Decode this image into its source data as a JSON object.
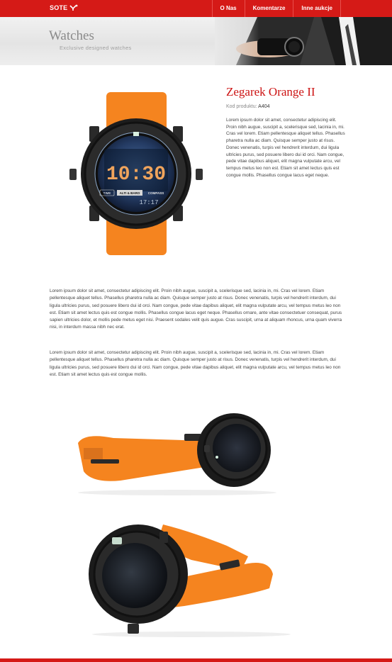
{
  "header": {
    "logo_text": "SOTE",
    "nav": [
      {
        "label": "O Nas"
      },
      {
        "label": "Komentarze"
      },
      {
        "label": "Inne aukcje"
      }
    ]
  },
  "hero": {
    "title": "Watches",
    "subtitle": "Exclusive designed watches"
  },
  "product": {
    "title": "Zegarek Orange II",
    "code_label": "Kod produktu:",
    "code_value": "A404",
    "description": "Lorem ipsum dolor sit amet, consectetur adipiscing elit. Proin nibh augue, suscipit a, scelerisque sed, lacinia in, mi. Cras vel lorem. Etiam pellentesque aliquet tellus. Phasellus pharetra nulla ac diam. Quisque semper justo at risus. Donec venenatis, turpis vel hendrerit interdum, dui ligula ultricies purus, sed posuere libero dui id orci. Nam congue, pede vitae dapibus aliquet, elit magna vulputate arcu, vel tempus metus leo non est. Etiam sit amet lectus quis est congue mollis. Phasellus congue lacus eget neque.",
    "watch_display": {
      "time": "10:30",
      "left_label": "TIME",
      "mode_1": "ALTI & BARO",
      "mode_2": "COMPASS",
      "seconds": "17:17"
    }
  },
  "content": {
    "paragraph_1": "Lorem ipsum dolor sit amet, consectetur adipiscing elit. Proin nibh augue, suscipit a, scelerisque sed, lacinia in, mi. Cras vel lorem. Etiam pellentesque aliquet tellus. Phasellus pharetra nulla ac diam. Quisque semper justo at risus. Donec venenatis, turpis vel hendrerit interdum, dui ligula ultricies purus, sed posuere libero dui id orci. Nam congue, pede vitae dapibus aliquet, elit magna vulputate arcu, vel tempus metus leo non est. Etiam sit amet lectus quis est congue mollis. Phasellus congue lacus eget neque. Phasellus ornare, ante vitae consectetuer consequat, purus sapien ultricies dolor, et mollis pede metus eget nisi. Praesent sodales velit quis augue. Cras suscipit, urna at aliquam rhoncus, urna quam viverra nisi, in interdum massa nibh nec erat.",
    "paragraph_2": "Lorem ipsum dolor sit amet, consectetur adipiscing elit. Proin nibh augue, suscipit a, scelerisque sed, lacinia in, mi. Cras vel lorem. Etiam pellentesque aliquet tellus. Phasellus pharetra nulla ac diam. Quisque semper justo at risus. Donec venenatis, turpis vel hendrerit interdum, dui ligula ultricies purus, sed posuere libero dui id orci. Nam congue, pede vitae dapibus aliquet, elit magna vulputate arcu, vel tempus metus leo non est. Etiam sit amet lectus quis est congue mollis."
  },
  "colors": {
    "brand_red": "#d51a17",
    "title_red": "#cc1212",
    "strap_orange": "#f5841f"
  },
  "icons": {
    "logo_mark": "logo-arrows-icon"
  }
}
